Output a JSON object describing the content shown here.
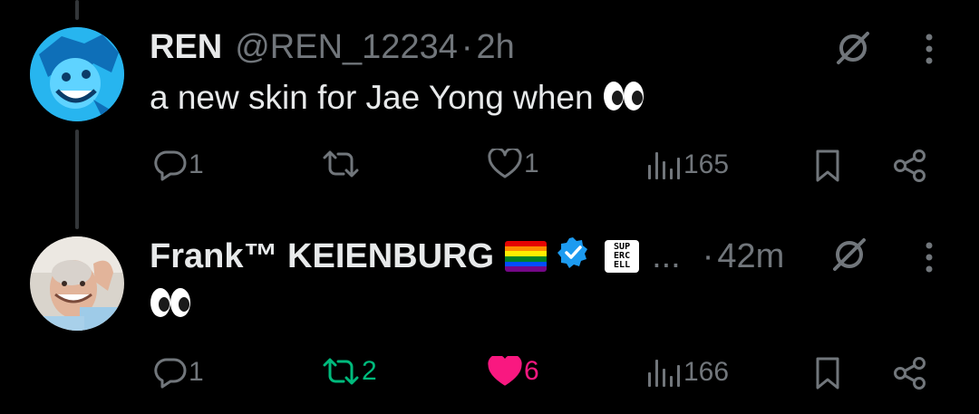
{
  "tweet1": {
    "name": "REN",
    "handle": "@REN_12234",
    "separator": "·",
    "time": "2h",
    "text": "a new skin for Jae Yong when",
    "emoji": "eyes-emoji",
    "actions": {
      "reply_count": "1",
      "retweet_count": "",
      "like_count": "1",
      "views_count": "165"
    },
    "colors": {
      "avatar": "#1da7e6",
      "reply": "#71767b",
      "retweet": "#71767b",
      "like": "#71767b"
    }
  },
  "tweet2": {
    "name": "Frank™ KEIENBURG",
    "flag": "rainbow-flag-emoji",
    "verified": "verified-badge-icon",
    "affiliate_label": "SUP ERC ELL",
    "ellipsis": "...",
    "separator": "·",
    "time": "42m",
    "emoji": "eyes-emoji",
    "actions": {
      "reply_count": "1",
      "retweet_count": "2",
      "like_count": "6",
      "views_count": "166"
    },
    "colors": {
      "retweet_active": "#00ba7c",
      "like_active": "#f91880",
      "verified": "#1d9bf0"
    }
  }
}
